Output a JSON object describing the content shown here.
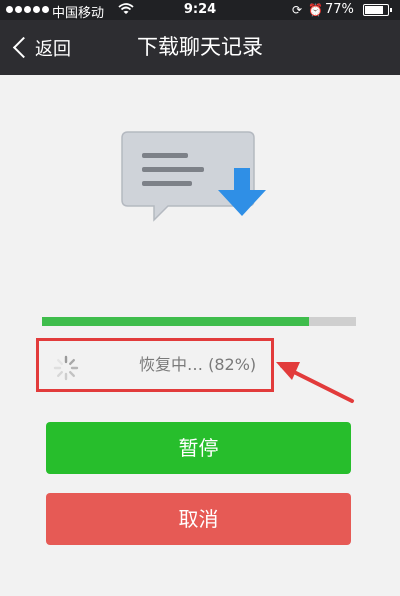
{
  "status_bar": {
    "carrier": "中国移动",
    "time": "9:24",
    "battery": "77%",
    "battery_level": 0.77
  },
  "nav": {
    "back_label": "返回",
    "title": "下载聊天记录"
  },
  "progress": {
    "fraction": 0.85,
    "status_text": "恢复中… (82%)"
  },
  "buttons": {
    "pause_label": "暂停",
    "cancel_label": "取消"
  },
  "colors": {
    "progress_fill": "#3fbd4c",
    "pause_button": "#27be2c",
    "cancel_button": "#e65a55",
    "highlight": "#e23b3b",
    "download_arrow": "#2f8fe6"
  }
}
